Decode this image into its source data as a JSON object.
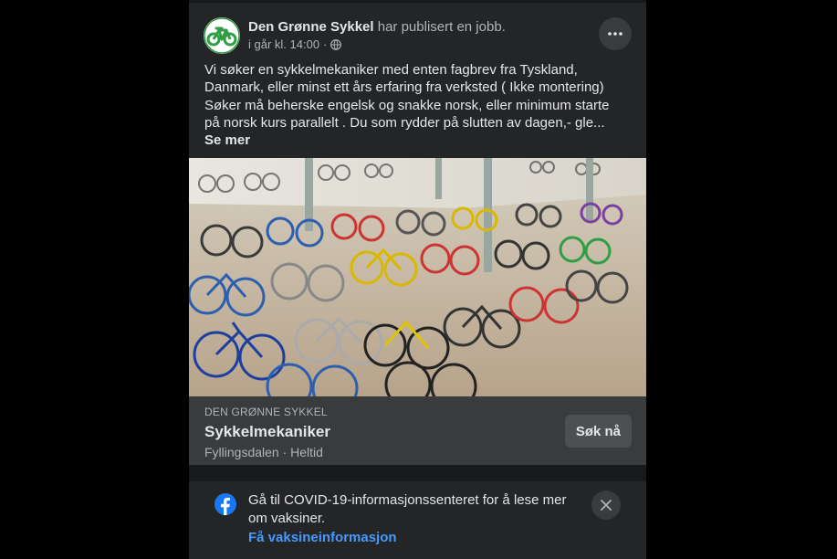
{
  "post": {
    "author": "Den Grønne Sykkel",
    "action": "har publisert en jobb.",
    "timestamp": "i går kl. 14:00",
    "text_lines": [
      "Vi søker en sykkelmekaniker med enten fagbrev fra Tyskland,",
      "Danmark, eller minst ett års erfaring fra verksted ( Ikke montering)",
      "Søker må beherske engelsk og snakke norsk, eller minimum starte",
      "på norsk kurs parallelt . Du som rydder på slutten av dagen,- gle..."
    ],
    "see_more": "Se mer"
  },
  "job": {
    "company": "DEN GRØNNE SYKKEL",
    "title": "Sykkelmekaniker",
    "location": "Fyllingsdalen · Heltid",
    "apply_label": "Søk nå"
  },
  "covid": {
    "text": "Gå til COVID-19-informasjonssenteret for å lese mer om vaksiner.",
    "link": "Få vaksineinformasjon"
  },
  "icons": {
    "privacy": "globe-icon",
    "more": "more-dots-icon",
    "close": "close-icon",
    "facebook": "facebook-logo-icon"
  },
  "colors": {
    "background": "#18191a",
    "card": "#242526",
    "surface": "#3a3b3c",
    "link": "#4599ff",
    "brand_green": "#2f9e44",
    "facebook_blue": "#1877f2"
  }
}
